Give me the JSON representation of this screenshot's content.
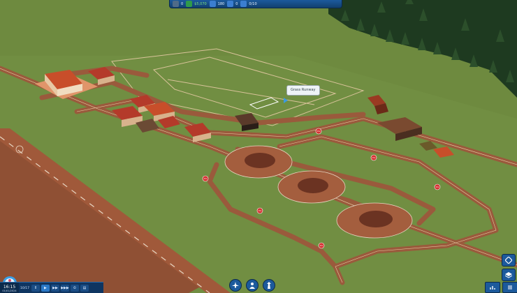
{
  "hud": {
    "level_value": "0",
    "money_value": "$5,070",
    "reputation_value": "180",
    "alerts_value": "0",
    "flights_value": "0/10"
  },
  "tooltip": {
    "text": "Grass Runway"
  },
  "world": {
    "stand_labels": [
      "15L",
      "15L",
      "15L",
      "15L",
      "15L",
      "15L"
    ]
  },
  "clock": {
    "time": "16:15",
    "date": "01/01/2024",
    "day": "10/17"
  },
  "speed": {
    "buttons": [
      "II",
      "▶",
      "▶▶",
      "▶▶▶",
      "⏲",
      "▤"
    ]
  },
  "colors": {
    "grass": "#6e8a3f",
    "taxiway": "#9a5a3c",
    "hud_blue": "#1c5a9c",
    "money": "#7de07b"
  }
}
